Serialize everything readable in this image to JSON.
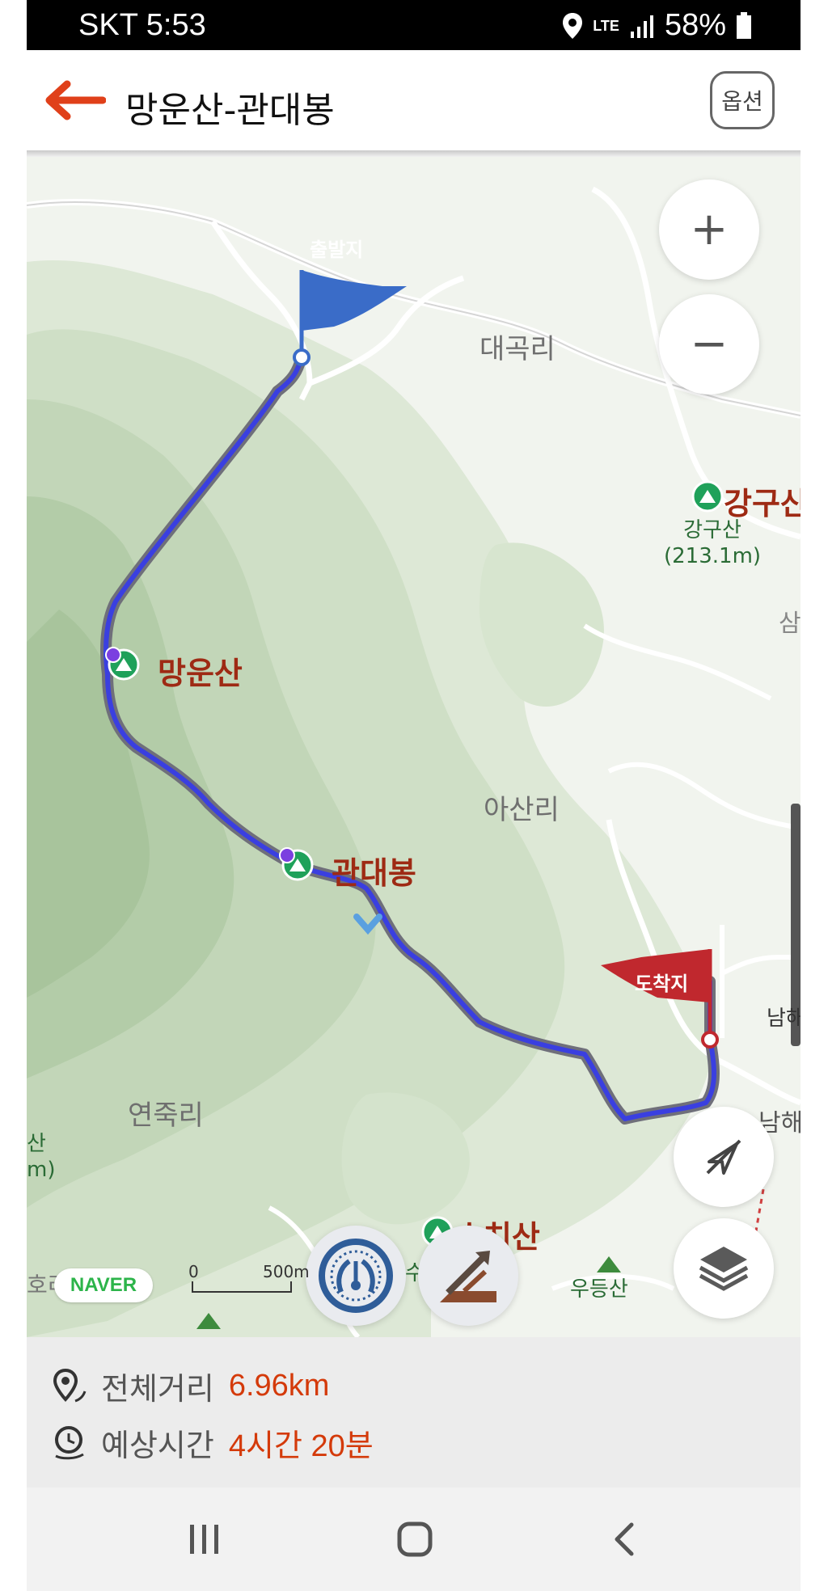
{
  "status_bar": {
    "carrier_time": "SKT 5:53",
    "network": "LTE",
    "battery": "58%"
  },
  "header": {
    "title": "망운산-관대봉",
    "option_label": "옵션"
  },
  "map": {
    "start_flag": "출발지",
    "end_flag": "도착지",
    "places": {
      "daegok": "대곡리",
      "asan": "아산리",
      "yeonjuk": "연죽리",
      "udeung": "우등산",
      "namhae": "남해",
      "namhae_eup": "남해읍",
      "sam": "삼",
      "ho": "호리",
      "su": "수"
    },
    "peaks": {
      "mangun": "망운산",
      "gwandae": "관대봉",
      "ganggu": "강구산",
      "ganggu_small": "강구산",
      "ganggu_elev": "(213.1m)",
      "suchi": "수치산",
      "left_cut1": "산",
      "left_cut2": "m)"
    },
    "scale": {
      "zero": "0",
      "dist": "500m"
    },
    "naver_logo": "NAVER",
    "controls": {
      "zoom_in": "+",
      "zoom_out": "−"
    }
  },
  "summary": {
    "distance_label": "전체거리",
    "distance_value": "6.96km",
    "time_label": "예상시간",
    "time_value": "4시간 20분"
  },
  "colors": {
    "route": "#3a3fe0",
    "start_flag": "#3a6cc8",
    "end_flag": "#c0282e",
    "accent": "#d43a0a"
  }
}
